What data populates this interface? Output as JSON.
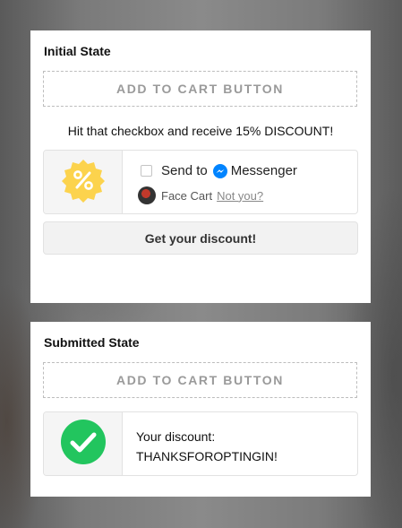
{
  "initial": {
    "title": "Initial State",
    "atc_label": "ADD TO CART BUTTON",
    "promo_text": "Hit that checkbox and receive 15% DISCOUNT!",
    "send_to_label": "Send to",
    "messenger_label": "Messenger",
    "user_name": "Face Cart",
    "not_you_label": "Not you?",
    "discount_button_label": "Get your discount!",
    "icons": {
      "badge": "discount-percent-badge",
      "messenger": "messenger-logo",
      "avatar": "user-avatar"
    }
  },
  "submitted": {
    "title": "Submitted State",
    "atc_label": "ADD TO CART BUTTON",
    "discount_label": "Your discount:",
    "discount_code": "THANKSFOROPTINGIN!",
    "icons": {
      "check": "success-check"
    }
  },
  "colors": {
    "badge_yellow": "#fcd34d",
    "messenger_blue": "#0084ff",
    "success_green": "#22c55e"
  }
}
